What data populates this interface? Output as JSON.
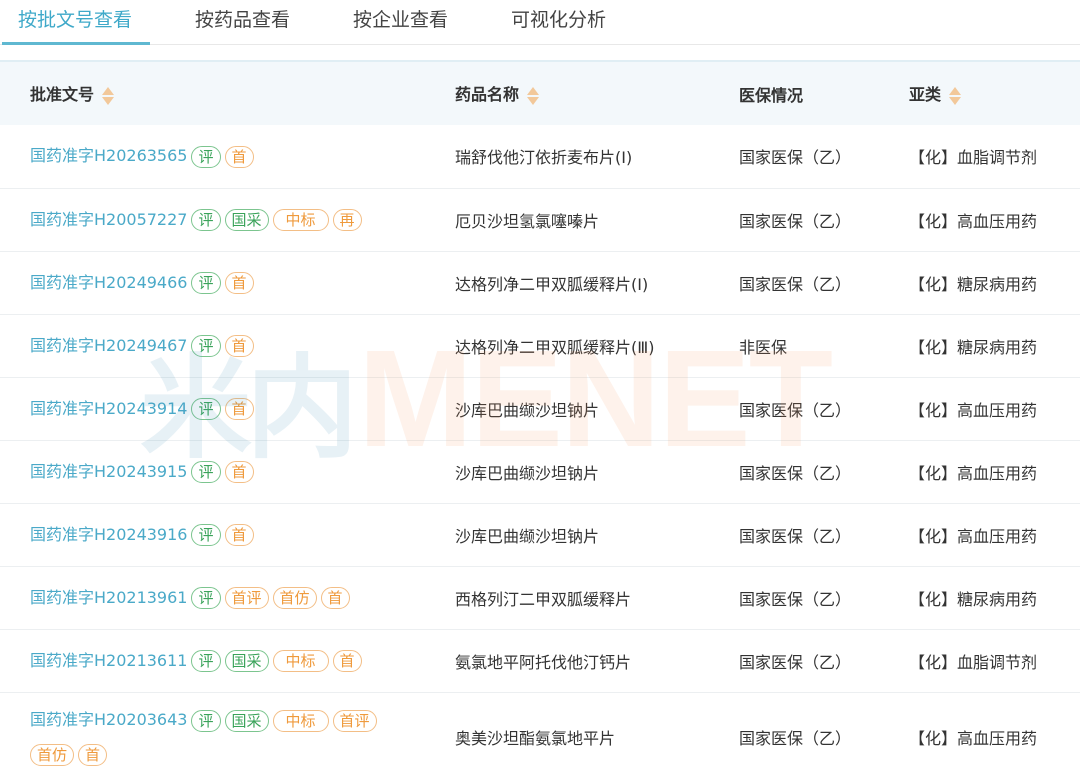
{
  "tabs": [
    {
      "label": "按批文号查看",
      "active": true
    },
    {
      "label": "按药品查看",
      "active": false
    },
    {
      "label": "按企业查看",
      "active": false
    },
    {
      "label": "可视化分析",
      "active": false
    }
  ],
  "columns": [
    "批准文号",
    "药品名称",
    "医保情况",
    "亚类"
  ],
  "rows": [
    {
      "approval": "国药准字H20263565",
      "badges": [
        {
          "text": "评",
          "color": "green"
        },
        {
          "text": "首",
          "color": "orange"
        }
      ],
      "drug": "瑞舒伐他汀依折麦布片(Ⅰ)",
      "insurance": "国家医保（乙）",
      "category": "【化】血脂调节剂"
    },
    {
      "approval": "国药准字H20057227",
      "badges": [
        {
          "text": "评",
          "color": "green"
        },
        {
          "text": "国采",
          "color": "green"
        },
        {
          "text": "中标",
          "color": "orange"
        },
        {
          "text": "再",
          "color": "orange"
        }
      ],
      "drug": "厄贝沙坦氢氯噻嗪片",
      "insurance": "国家医保（乙）",
      "category": "【化】高血压用药"
    },
    {
      "approval": "国药准字H20249466",
      "badges": [
        {
          "text": "评",
          "color": "green"
        },
        {
          "text": "首",
          "color": "orange"
        }
      ],
      "drug": "达格列净二甲双胍缓释片(Ⅰ)",
      "insurance": "国家医保（乙）",
      "category": "【化】糖尿病用药"
    },
    {
      "approval": "国药准字H20249467",
      "badges": [
        {
          "text": "评",
          "color": "green"
        },
        {
          "text": "首",
          "color": "orange"
        }
      ],
      "drug": "达格列净二甲双胍缓释片(Ⅲ)",
      "insurance": "非医保",
      "category": "【化】糖尿病用药"
    },
    {
      "approval": "国药准字H20243914",
      "badges": [
        {
          "text": "评",
          "color": "green"
        },
        {
          "text": "首",
          "color": "orange"
        }
      ],
      "drug": "沙库巴曲缬沙坦钠片",
      "insurance": "国家医保（乙）",
      "category": "【化】高血压用药"
    },
    {
      "approval": "国药准字H20243915",
      "badges": [
        {
          "text": "评",
          "color": "green"
        },
        {
          "text": "首",
          "color": "orange"
        }
      ],
      "drug": "沙库巴曲缬沙坦钠片",
      "insurance": "国家医保（乙）",
      "category": "【化】高血压用药"
    },
    {
      "approval": "国药准字H20243916",
      "badges": [
        {
          "text": "评",
          "color": "green"
        },
        {
          "text": "首",
          "color": "orange"
        }
      ],
      "drug": "沙库巴曲缬沙坦钠片",
      "insurance": "国家医保（乙）",
      "category": "【化】高血压用药"
    },
    {
      "approval": "国药准字H20213961",
      "badges": [
        {
          "text": "评",
          "color": "green"
        },
        {
          "text": "首评",
          "color": "orange"
        },
        {
          "text": "首仿",
          "color": "orange"
        },
        {
          "text": "首",
          "color": "orange"
        }
      ],
      "drug": "西格列汀二甲双胍缓释片",
      "insurance": "国家医保（乙）",
      "category": "【化】糖尿病用药"
    },
    {
      "approval": "国药准字H20213611",
      "badges": [
        {
          "text": "评",
          "color": "green"
        },
        {
          "text": "国采",
          "color": "green"
        },
        {
          "text": "中标",
          "color": "orange"
        },
        {
          "text": "首",
          "color": "orange"
        }
      ],
      "drug": "氨氯地平阿托伐他汀钙片",
      "insurance": "国家医保（乙）",
      "category": "【化】血脂调节剂"
    },
    {
      "approval": "国药准字H20203643",
      "badges": [
        {
          "text": "评",
          "color": "green"
        },
        {
          "text": "国采",
          "color": "green"
        },
        {
          "text": "中标",
          "color": "orange"
        },
        {
          "text": "首评",
          "color": "orange"
        },
        {
          "text": "首仿",
          "color": "orange"
        },
        {
          "text": "首",
          "color": "orange"
        }
      ],
      "drug": "奥美沙坦酯氨氯地平片",
      "insurance": "国家医保（乙）",
      "category": "【化】高血压用药"
    }
  ],
  "watermark": {
    "cn": "米内",
    "en": "MENET"
  },
  "colors": {
    "accent": "#4aa9c8",
    "green_badge": "#3aa35a",
    "orange_badge": "#ef9a3c",
    "sort_icon": "#f2c89a"
  }
}
